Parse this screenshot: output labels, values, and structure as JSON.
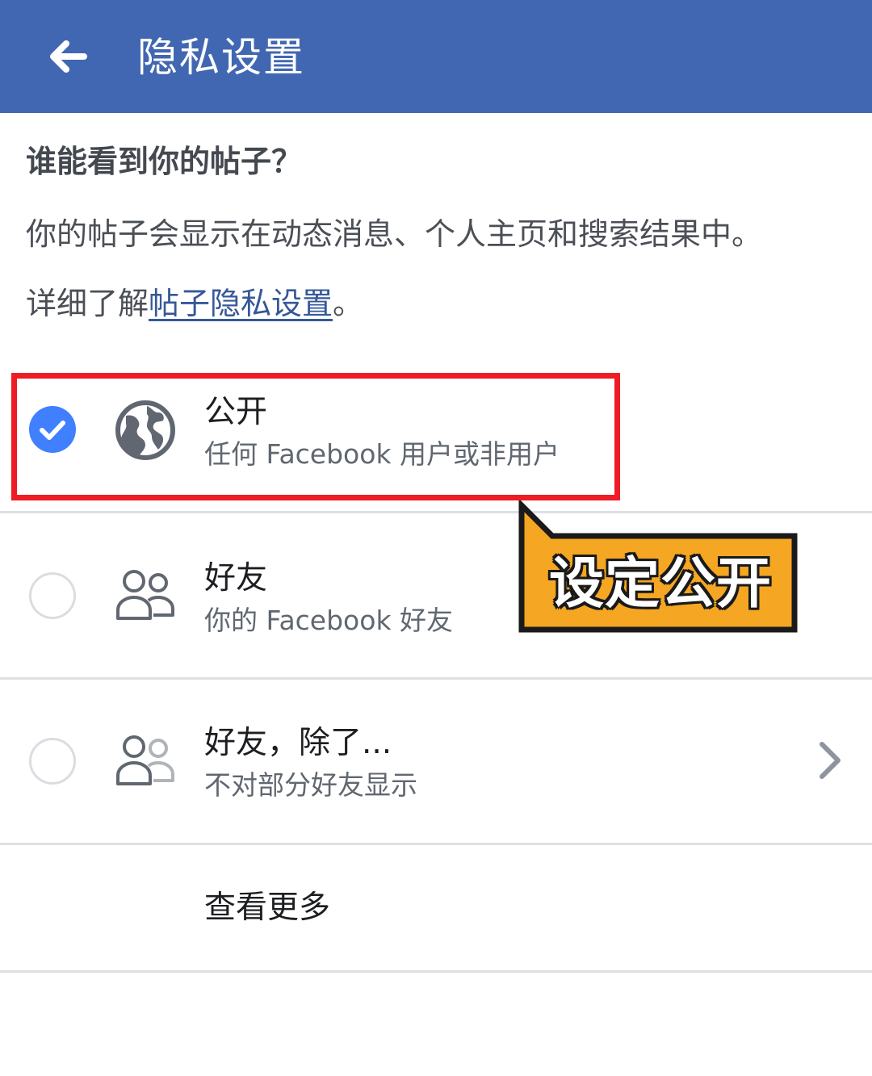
{
  "header": {
    "title": "隐私设置",
    "back_icon": "arrow-left-icon",
    "bg_color": "#4267b2"
  },
  "section": {
    "title": "谁能看到你的帖子？",
    "description": "你的帖子会显示在动态消息、个人主页和搜索结果中。",
    "learn_prefix": "详细了解",
    "learn_link": "帖子隐私设置",
    "learn_suffix": "。"
  },
  "options": [
    {
      "title": "公开",
      "subtitle": "任何 Facebook 用户或非用户",
      "icon": "globe-icon",
      "selected": true
    },
    {
      "title": "好友",
      "subtitle": "你的 Facebook 好友",
      "icon": "friends-icon",
      "selected": false
    },
    {
      "title": "好友，除了...",
      "subtitle": "不对部分好友显示",
      "icon": "friends-except-icon",
      "selected": false,
      "chevron": true
    }
  ],
  "see_more": "查看更多",
  "annotation": {
    "label": "设定公开",
    "box_color": "#ee1c24",
    "callout_color": "#f5a623"
  },
  "colors": {
    "accent": "#4080ff",
    "link": "#365899"
  }
}
